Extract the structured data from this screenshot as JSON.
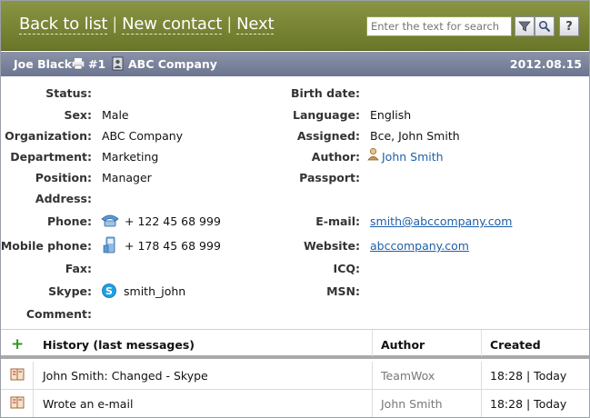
{
  "nav": {
    "back": "Back to list",
    "sep1": "|",
    "new_contact": "New contact",
    "sep2": "|",
    "next": "Next"
  },
  "search": {
    "placeholder": "Enter the text for search",
    "help": "?"
  },
  "contact": {
    "name": "Joe Black",
    "number": "#1",
    "company": "ABC Company",
    "date": "2012.08.15"
  },
  "fields_left": {
    "status": {
      "label": "Status:",
      "value": ""
    },
    "sex": {
      "label": "Sex:",
      "value": "Male"
    },
    "organization": {
      "label": "Organization:",
      "value": "ABC Company"
    },
    "department": {
      "label": "Department:",
      "value": "Marketing"
    },
    "position": {
      "label": "Position:",
      "value": "Manager"
    },
    "address": {
      "label": "Address:",
      "value": ""
    },
    "phone": {
      "label": "Phone:",
      "value": "+ 122 45 68 999"
    },
    "mobile": {
      "label": "Mobile phone:",
      "value": "+ 178 45 68 999"
    },
    "fax": {
      "label": "Fax:",
      "value": ""
    },
    "skype": {
      "label": "Skype:",
      "value": "smith_john"
    },
    "comment": {
      "label": "Comment:",
      "value": ""
    }
  },
  "fields_right": {
    "birth_date": {
      "label": "Birth date:",
      "value": ""
    },
    "language": {
      "label": "Language:",
      "value": "English"
    },
    "assigned": {
      "label": "Assigned:",
      "value": "Bce, John Smith"
    },
    "author": {
      "label": "Author:",
      "value": "John Smith"
    },
    "passport": {
      "label": "Passport:",
      "value": ""
    },
    "email": {
      "label": "E-mail:",
      "value": "smith@abccompany.com"
    },
    "website": {
      "label": "Website:",
      "value": "abccompany.com"
    },
    "icq": {
      "label": "ICQ:",
      "value": ""
    },
    "msn": {
      "label": "MSN:",
      "value": ""
    }
  },
  "history": {
    "add": "+",
    "headers": {
      "message": "History (last messages)",
      "author": "Author",
      "created": "Created"
    },
    "rows": [
      {
        "message": "John Smith: Changed - Skype",
        "author": "TeamWox",
        "created": "18:28 | Today"
      },
      {
        "message": "Wrote an e-mail",
        "author": "John Smith",
        "created": "18:28 | Today"
      }
    ]
  },
  "colors": {
    "header_olive": "#7a8535",
    "titlebar": "#7a8299",
    "link": "#1f5fa8",
    "add_green": "#2e9a1e"
  }
}
